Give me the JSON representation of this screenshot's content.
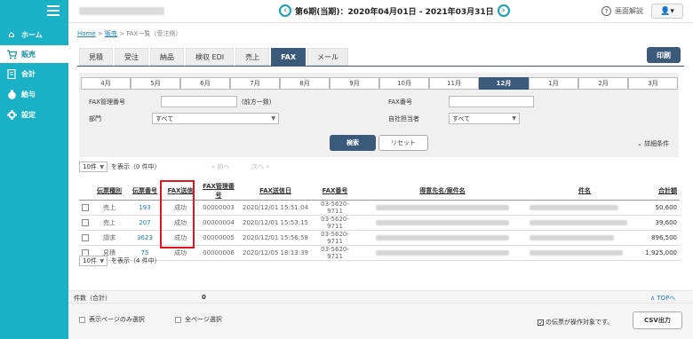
{
  "sidebar": {
    "items": [
      {
        "label": "ホーム",
        "icon": "home-icon",
        "glyph": "⌂"
      },
      {
        "label": "販売",
        "icon": "cart-icon",
        "glyph": "🛒"
      },
      {
        "label": "会計",
        "icon": "ledger-icon",
        "glyph": "▤"
      },
      {
        "label": "給与",
        "icon": "moneybag-icon",
        "glyph": "●"
      },
      {
        "label": "設定",
        "icon": "gear-icon",
        "glyph": "✱"
      }
    ]
  },
  "header": {
    "prev_glyph": "‹",
    "next_glyph": "›",
    "period": "第6期(当期)：2020年04月01日 - 2021年03月31日",
    "help_glyph": "?",
    "help_label": "画面解説",
    "user_glyph": "👤▾"
  },
  "breadcrumb": {
    "home": "Home",
    "sep1": ">",
    "sales": "販売",
    "sep2": ">",
    "current": "FAX一覧（受注側）"
  },
  "tabs": [
    "見積",
    "受注",
    "納品",
    "検収 EDI",
    "売上",
    "FAX",
    "メール"
  ],
  "active_tab": "FAX",
  "print_label": "印刷",
  "months": [
    "4月",
    "5月",
    "6月",
    "7月",
    "8月",
    "9月",
    "10月",
    "11月",
    "12月",
    "1月",
    "2月",
    "3月"
  ],
  "active_month": "12月",
  "filter": {
    "fax_mgmt_label": "FAX管理番号",
    "fax_mgmt_value": "",
    "fax_mgmt_hint": "(前方一致)",
    "fax_no_label": "FAX番号",
    "fax_no_value": "",
    "dept_label": "部門",
    "dept_value": "すべて",
    "owner_label": "自社担当者",
    "owner_value": "すべて",
    "search_label": "検索",
    "reset_label": "リセット",
    "detail_label": "詳細条件",
    "detail_glyph": "⌄"
  },
  "pager_top": {
    "per_page": "10件",
    "showing": "を表示（0 件中）",
    "prev": "« 前へ",
    "next": "次へ »"
  },
  "pager_bottom": {
    "per_page": "10件",
    "showing": "を表示（4 件中）"
  },
  "table": {
    "headers": [
      "伝票種別",
      "伝票番号",
      "FAX送信",
      "FAX管理番号",
      "FAX送信日",
      "FAX番号",
      "得意先名/案件名",
      "件名",
      "合計額"
    ],
    "rows": [
      {
        "type": "売上",
        "no": "193",
        "status": "成功",
        "mgmt": "00000003",
        "date": "2020/12/01 15:51:04",
        "fax": "03-5620-9711",
        "amount": "50,600"
      },
      {
        "type": "売上",
        "no": "207",
        "status": "成功",
        "mgmt": "00000004",
        "date": "2020/12/01 15:53:15",
        "fax": "03-5620-9711",
        "amount": "39,600"
      },
      {
        "type": "請求",
        "no": "3623",
        "status": "成功",
        "mgmt": "00000005",
        "date": "2020/12/01 15:56:58",
        "fax": "03-5620-9711",
        "amount": "896,500"
      },
      {
        "type": "見積",
        "no": "75",
        "status": "成功",
        "mgmt": "00000006",
        "date": "2020/12/05 18:13:39",
        "fax": "03-5620-9711",
        "amount": "1,925,000"
      }
    ]
  },
  "footer": {
    "count_label": "件数（合計）",
    "count_value": "0",
    "top_label": "∧ TOPへ",
    "select_page": "表示ページのみ選択",
    "select_all": "全ページ選択",
    "target_note": "の伝票が操作対象です。",
    "target_glyph": "✓",
    "csv_label": "CSV出力"
  },
  "colors": {
    "sidebar": "#1ab0c6",
    "accent": "#3b5a7a",
    "link": "#1a7fb6",
    "highlight": "#e0141e"
  }
}
